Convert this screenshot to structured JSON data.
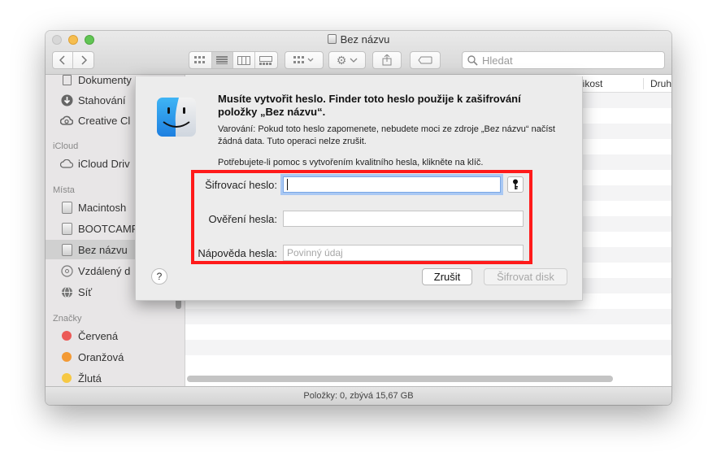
{
  "window": {
    "title": "Bez názvu"
  },
  "toolbar": {
    "back_icon": "chevron-left-icon",
    "forward_icon": "chevron-right-icon",
    "view_icons": [
      "icon-view-icon",
      "list-view-icon",
      "column-view-icon",
      "gallery-view-icon"
    ],
    "group_icon": "group-icon",
    "action_icon": "gear-icon",
    "share_icon": "share-icon",
    "tag_icon": "tag-icon"
  },
  "search": {
    "placeholder": "Hledat"
  },
  "sidebar": {
    "items_top": [
      {
        "label": "Dokumenty",
        "icon": "documents-icon"
      },
      {
        "label": "Stahování",
        "icon": "download-icon"
      },
      {
        "label": "Creative Cl",
        "icon": "creative-cloud-icon"
      }
    ],
    "icloud_header": "iCloud",
    "icloud_items": [
      {
        "label": "iCloud Driv",
        "icon": "cloud-icon"
      }
    ],
    "places_header": "Místa",
    "places_items": [
      {
        "label": "Macintosh",
        "icon": "drive-icon"
      },
      {
        "label": "BOOTCAMP",
        "icon": "drive-icon"
      },
      {
        "label": "Bez názvu",
        "icon": "drive-icon",
        "selected": true
      },
      {
        "label": "Vzdálený d",
        "icon": "remote-disc-icon"
      },
      {
        "label": "Síť",
        "icon": "network-icon"
      }
    ],
    "tags_header": "Značky",
    "tags": [
      {
        "label": "Červená",
        "color": "#ec5a57"
      },
      {
        "label": "Oranžová",
        "color": "#f39a35"
      },
      {
        "label": "Žlutá",
        "color": "#f6c844"
      }
    ]
  },
  "columns": {
    "size": "likost",
    "kind": "Druh"
  },
  "status": {
    "text": "Položky: 0, zbývá 15,67 GB"
  },
  "dialog": {
    "icon": "finder-icon",
    "title": "Musíte vytvořit heslo. Finder toto heslo použije k zašifrování položky „Bez názvu“.",
    "warning": "Varování: Pokud toto heslo zapomenete, nebudete moci ze zdroje „Bez názvu“ načíst žádná data. Tuto operaci nelze zrušit.",
    "help_text": "Potřebujete-li pomoc s vytvořením kvalitního hesla, klikněte na klíč.",
    "password_label": "Šifrovací heslo:",
    "password_value": "",
    "verify_label": "Ověření hesla:",
    "verify_value": "",
    "hint_label": "Nápověda hesla:",
    "hint_placeholder": "Povinný údaj",
    "key_icon": "key-icon",
    "help_button": "?",
    "cancel_label": "Zrušit",
    "encrypt_label": "Šifrovat disk"
  }
}
